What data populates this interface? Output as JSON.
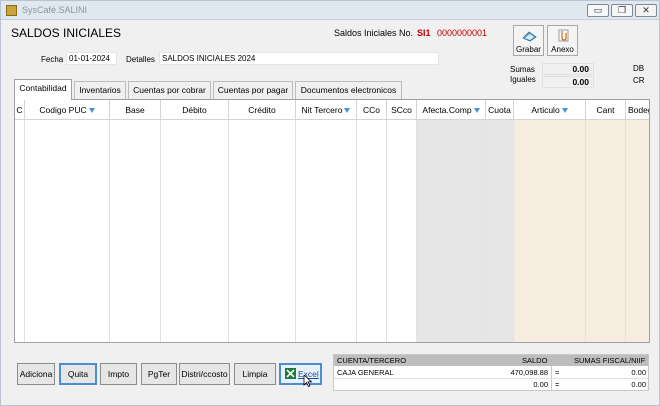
{
  "window": {
    "title": "SysCafé.SALINI",
    "controls": {
      "minimize": "▭",
      "restore": "❐",
      "close": "✕"
    }
  },
  "header": {
    "title": "SALDOS INICIALES",
    "doc_label": "Saldos Iniciales  No.",
    "doc_code": "SI1",
    "doc_number": "0000000001"
  },
  "toolbar": {
    "grabar_label": "Grabar",
    "anexo_label": "Anexo",
    "grabar_icon": "save-icon",
    "anexo_icon": "attach-icon"
  },
  "form": {
    "fecha_label": "Fecha",
    "fecha_value": "01-01-2024",
    "detalles_label": "Detalles",
    "detalles_value": "SALDOS INICIALES 2024"
  },
  "sums": {
    "sumas_label": "Sumas",
    "iguales_label": "Iguales",
    "db_value": "0.00",
    "cr_value": "0.00",
    "db_label": "DB",
    "cr_label": "CR"
  },
  "tabs": [
    {
      "label": "Contabilidad"
    },
    {
      "label": "Inventarios"
    },
    {
      "label": "Cuentas por cobrar"
    },
    {
      "label": "Cuentas por pagar"
    },
    {
      "label": "Documentos electronicos"
    }
  ],
  "grid": {
    "columns": [
      "C",
      "Codigo PUC",
      "Base",
      "Débito",
      "Crédito",
      "Nit Tercero",
      "CCo",
      "SCco",
      "Afecta.Comp",
      "Cuota",
      "Articulo",
      "Cant",
      "Bodeg"
    ],
    "sortable": [
      "Codigo PUC",
      "Nit Tercero",
      "Afecta.Comp",
      "Articulo"
    ]
  },
  "buttons": {
    "adiciona": "Adiciona",
    "quita": "Quita",
    "impto": "Impto",
    "pgter": "PgTer",
    "distri": "Distri/ccosto",
    "limpia": "Limpia",
    "excel": "Excel"
  },
  "summary": {
    "headers": {
      "cuenta": "CUENTA/TERCERO",
      "saldo": "SALDO",
      "fiscal": "SUMAS FISCAL/NIIF"
    },
    "rows": [
      {
        "cuenta": "CAJA GENERAL",
        "saldo": "470,098.88",
        "eq": "=",
        "fiscal": "0.00"
      },
      {
        "cuenta": "",
        "saldo": "0.00",
        "eq": "=",
        "fiscal": "0.00"
      }
    ]
  },
  "colors": {
    "doc_red": "#c00000",
    "sort_blue": "#4d8fd6",
    "grid_shade_gray": "#e6e6e6",
    "grid_shade_beige": "#f6ece0"
  }
}
